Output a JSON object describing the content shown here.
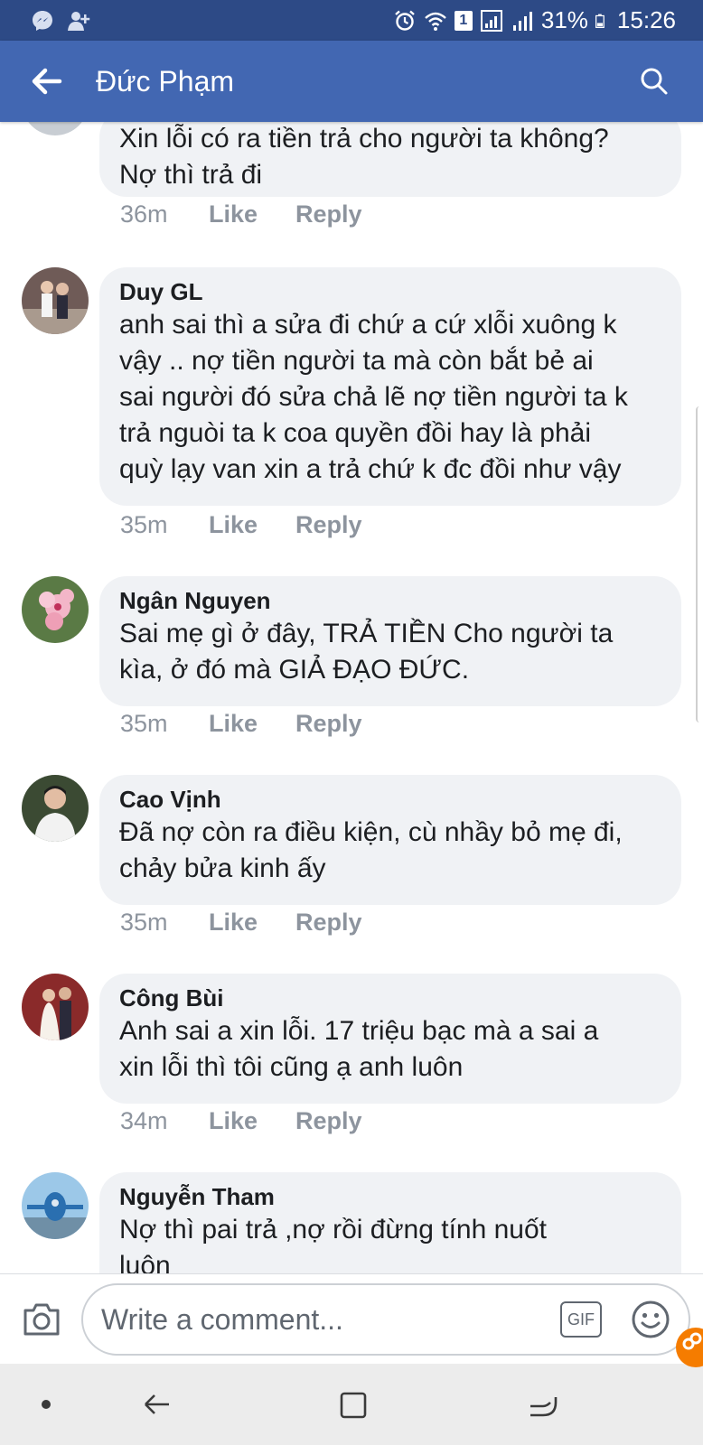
{
  "status_bar": {
    "badge": "1",
    "battery": "31%",
    "time": "15:26"
  },
  "header": {
    "title": "Đức Phạm"
  },
  "comments": [
    {
      "author": "",
      "text": "Xin lỗi có ra tiền trả cho người ta không?\nNợ thì trả đi",
      "time": "36m",
      "like": "Like",
      "reply": "Reply"
    },
    {
      "author": "Duy GL",
      "text": "anh sai thì a sửa đi chứ a cứ xlỗi xuông  k\nvậy .. nợ tiền người ta mà còn bắt bẻ ai\nsai người đó sửa chả lẽ nợ tiền người ta k\ntrả nguòi ta k coa quyền đồi hay là phải\nquỳ lạy van xin a trả chứ k đc đồi như vậy",
      "time": "35m",
      "like": "Like",
      "reply": "Reply"
    },
    {
      "author": "Ngân Nguyen",
      "text": "Sai mẹ gì ở đây, TRẢ TIỀN Cho người ta\nkìa, ở đó mà GIẢ ĐẠO ĐỨC.",
      "time": "35m",
      "like": "Like",
      "reply": "Reply"
    },
    {
      "author": "Cao Vịnh",
      "text": "Đã nợ còn ra điều kiện, cù nhầy bỏ mẹ đi,\nchảy bửa kinh ấy",
      "time": "35m",
      "like": "Like",
      "reply": "Reply"
    },
    {
      "author": "Công Bùi",
      "text": "Anh sai a xin lỗi. 17 triệu bạc mà a sai a\nxin lỗi thì tôi cũng ạ anh luôn",
      "time": "34m",
      "like": "Like",
      "reply": "Reply"
    },
    {
      "author": "Nguyễn Tham",
      "text": "Nợ thì  pai  trả  ,nợ rồi  đừng tính  nuốt\nluôn",
      "time": "",
      "like": "",
      "reply": ""
    }
  ],
  "composer": {
    "placeholder": "Write a comment...",
    "gif_label": "GIF"
  },
  "colors": {
    "status_bar": "#2d4a86",
    "header": "#4267b2",
    "bubble": "#f0f2f5",
    "meta_text": "#8d949e"
  }
}
